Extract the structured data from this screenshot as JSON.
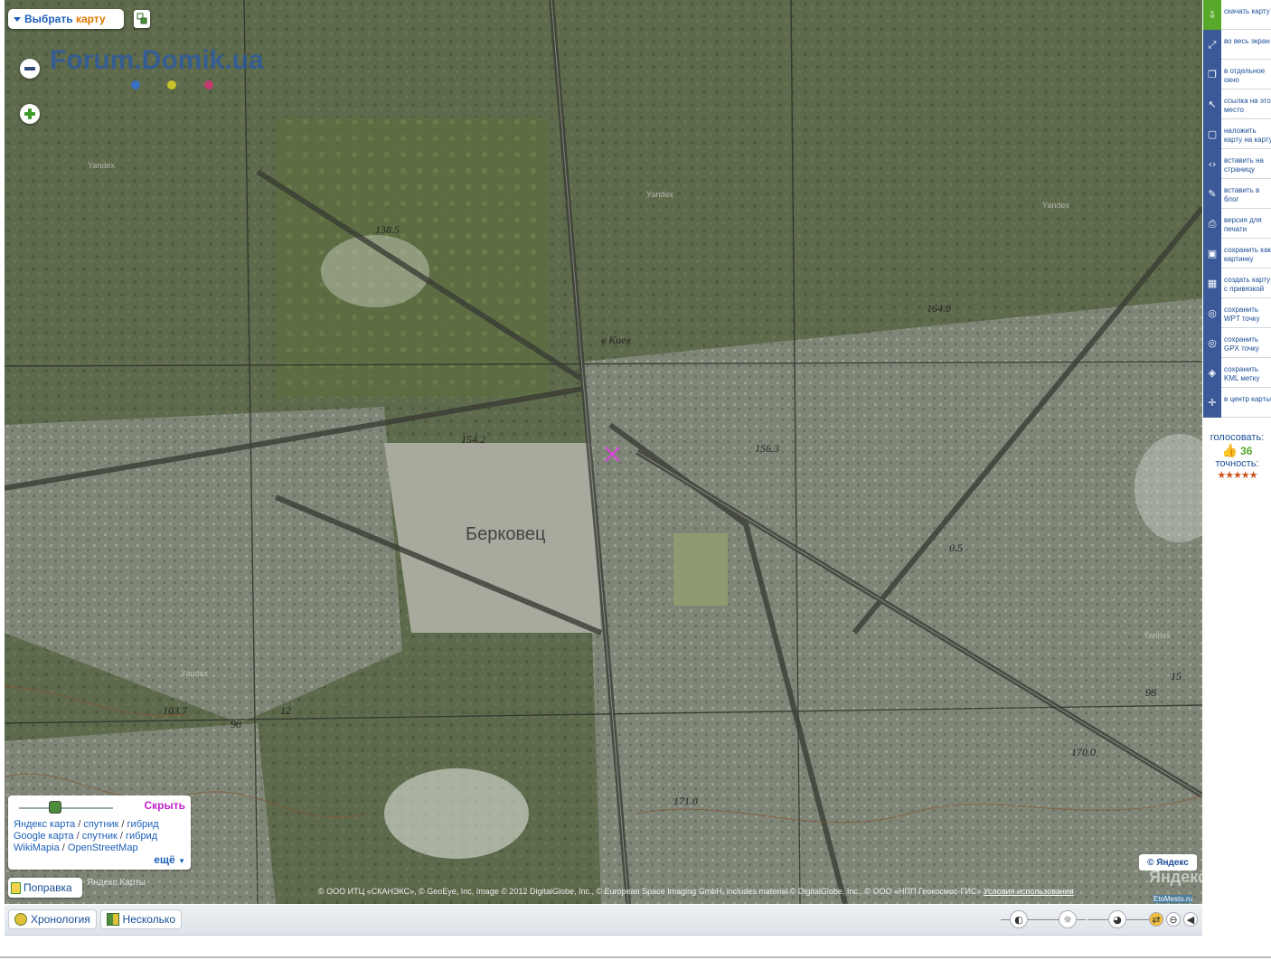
{
  "top_controls": {
    "choose_map_part1": "Выбрать",
    "choose_map_part2": "карту"
  },
  "logo": {
    "text": "Forum.Domik.ua",
    "dot_colors": [
      "#3b6fc2",
      "#c8c22a",
      "#c23b6f"
    ]
  },
  "map_labels": {
    "place": "Берковец",
    "h1": "138.5",
    "h2": "154.2",
    "h3": "156.3",
    "h4": "164.8",
    "h5": "171.0",
    "h6": "170.0",
    "h7": "103.7",
    "h8": "98",
    "road": "в Киев",
    "wm1": "Yandex",
    "wm2": "Yandex",
    "wm3": "Yandex",
    "wm4": "Yandex",
    "wm5": "Yandex",
    "num1": "12",
    "num2": "0.5",
    "num3": "15",
    "num4": "98"
  },
  "right_panel": {
    "items": [
      {
        "label": "скачать карту",
        "icon": "download-icon"
      },
      {
        "label": "во весь экран",
        "icon": "fullscreen-icon"
      },
      {
        "label": "в отдельное окно",
        "icon": "new-window-icon"
      },
      {
        "label": "ссылка на это место",
        "icon": "link-cursor-icon"
      },
      {
        "label": "наложить карту на карту",
        "icon": "overlay-icon"
      },
      {
        "label": "вставить на страницу",
        "icon": "embed-icon"
      },
      {
        "label": "вставить в блог",
        "icon": "blog-pencil-icon"
      },
      {
        "label": "версия для печати",
        "icon": "print-icon"
      },
      {
        "label": "сохранить как картинку",
        "icon": "save-image-icon"
      },
      {
        "label": "создать карту с привязкой",
        "icon": "grid-icon"
      },
      {
        "label": "сохранить WPT точку",
        "icon": "wpt-icon"
      },
      {
        "label": "сохранить GPX точку",
        "icon": "gpx-icon"
      },
      {
        "label": "сохранить KML метку",
        "icon": "kml-icon"
      },
      {
        "label": "в центр карты",
        "icon": "center-icon"
      }
    ],
    "vote_label": "голосовать:",
    "vote_count": "36",
    "accuracy_label": "точность:",
    "stars": "★★★★★"
  },
  "layer_box": {
    "hide": "Скрыть",
    "yandex_map": "Яндекс карта",
    "yandex_sat": "спутник",
    "yandex_hyb": "гибрид",
    "google_map": "Google карта",
    "google_sat": "спутник",
    "google_hyb": "гибрид",
    "wikimapia": "WikiMapia",
    "osm": "OpenStreetMap",
    "more": "ещё",
    "slash": "/"
  },
  "edit_button": "Поправка",
  "yandex_small": "Яндекс.Карты",
  "yandex_logo": "© Яндекс",
  "yandex_watermark": "Яндекс",
  "copyright": "© ООО ИТЦ «СКАНЭКС», © GeoEye, Inc, Image © 2012 DigitalGlobe, Inc., © European Space Imaging GmbH, includes material © DigitalGlobe, Inc., © ООО «НПП Геокосмос-ГИС»",
  "terms": "Условия использования",
  "etomesto": "EtoMesto.ru",
  "bottom_bar": {
    "chronology": "Хронология",
    "several": "Несколько"
  }
}
